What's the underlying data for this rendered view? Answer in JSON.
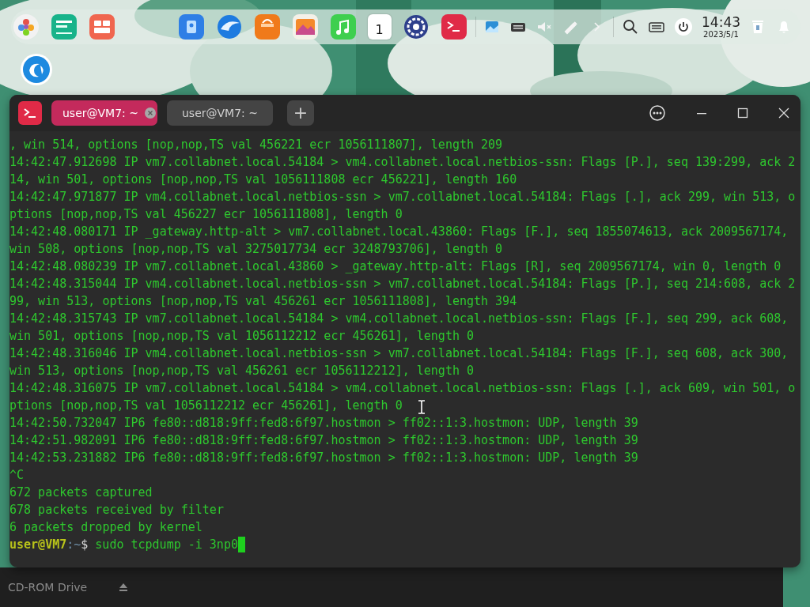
{
  "dock": {
    "calendar_day": "1",
    "clock": {
      "time": "14:43",
      "date": "2023/5/1"
    }
  },
  "behind_window": {
    "item": "CD-ROM Drive"
  },
  "terminal": {
    "tabs": [
      {
        "label": "user@VM7: ~",
        "selected": true
      },
      {
        "label": "user@VM7: ~",
        "selected": false
      }
    ],
    "new_tab": "+",
    "lines": [
      ", win 514, options [nop,nop,TS val 456221 ecr 1056111807], length 209",
      "14:42:47.912698 IP vm7.collabnet.local.54184 > vm4.collabnet.local.netbios-ssn: Flags [P.], seq 139:299, ack 2",
      "14, win 501, options [nop,nop,TS val 1056111808 ecr 456221], length 160",
      "14:42:47.971877 IP vm4.collabnet.local.netbios-ssn > vm7.collabnet.local.54184: Flags [.], ack 299, win 513, o",
      "ptions [nop,nop,TS val 456227 ecr 1056111808], length 0",
      "14:42:48.080171 IP _gateway.http-alt > vm7.collabnet.local.43860: Flags [F.], seq 1855074613, ack 2009567174,",
      "win 508, options [nop,nop,TS val 3275017734 ecr 3248793706], length 0",
      "14:42:48.080239 IP vm7.collabnet.local.43860 > _gateway.http-alt: Flags [R], seq 2009567174, win 0, length 0",
      "14:42:48.315044 IP vm4.collabnet.local.netbios-ssn > vm7.collabnet.local.54184: Flags [P.], seq 214:608, ack 2",
      "99, win 513, options [nop,nop,TS val 456261 ecr 1056111808], length 394",
      "14:42:48.315743 IP vm7.collabnet.local.54184 > vm4.collabnet.local.netbios-ssn: Flags [F.], seq 299, ack 608,",
      "win 501, options [nop,nop,TS val 1056112212 ecr 456261], length 0",
      "14:42:48.316046 IP vm4.collabnet.local.netbios-ssn > vm7.collabnet.local.54184: Flags [F.], seq 608, ack 300,",
      "win 513, options [nop,nop,TS val 456261 ecr 1056112212], length 0",
      "14:42:48.316075 IP vm7.collabnet.local.54184 > vm4.collabnet.local.netbios-ssn: Flags [.], ack 609, win 501, o",
      "ptions [nop,nop,TS val 1056112212 ecr 456261], length 0",
      "14:42:50.732047 IP6 fe80::d818:9ff:fed8:6f97.hostmon > ff02::1:3.hostmon: UDP, length 39",
      "14:42:51.982091 IP6 fe80::d818:9ff:fed8:6f97.hostmon > ff02::1:3.hostmon: UDP, length 39",
      "14:42:53.231882 IP6 fe80::d818:9ff:fed8:6f97.hostmon > ff02::1:3.hostmon: UDP, length 39",
      "^C",
      "672 packets captured",
      "678 packets received by filter",
      "6 packets dropped by kernel"
    ],
    "prompt": {
      "user": "user@VM7",
      "path": ":~",
      "symbol": "$",
      "command": "sudo tcpdump -i 3np0"
    }
  }
}
